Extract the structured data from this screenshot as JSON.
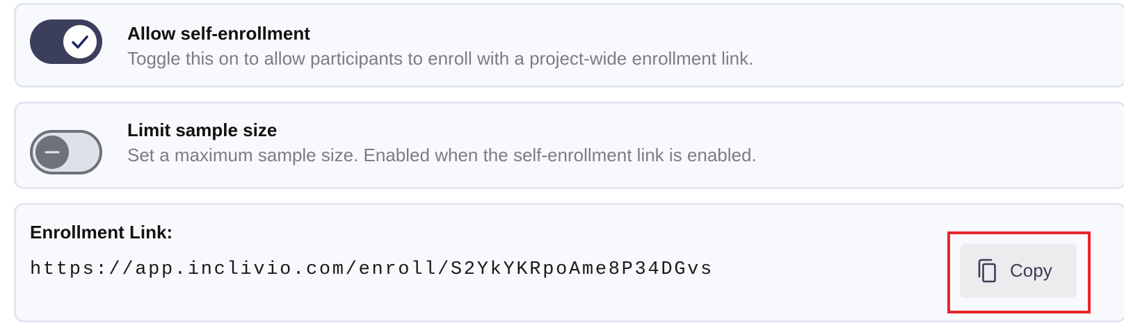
{
  "self_enrollment": {
    "title": "Allow self-enrollment",
    "description": "Toggle this on to allow participants to enroll with a project-wide enrollment link.",
    "enabled": true
  },
  "limit_sample": {
    "title": "Limit sample size",
    "description": "Set a maximum sample size. Enabled when the self-enrollment link is enabled.",
    "enabled": false
  },
  "enrollment_link": {
    "label": "Enrollment Link:",
    "url": "https://app.inclivio.com/enroll/S2YkYKRpoAme8P34DGvs",
    "copy_label": "Copy"
  },
  "icons": {
    "toggle_on": "check-icon",
    "toggle_off": "minus-icon",
    "copy": "copy-icon"
  },
  "colors": {
    "toggle_on_track": "#3b3f5c",
    "toggle_off_track": "#dfe1ea",
    "highlight": "#e8252b"
  }
}
